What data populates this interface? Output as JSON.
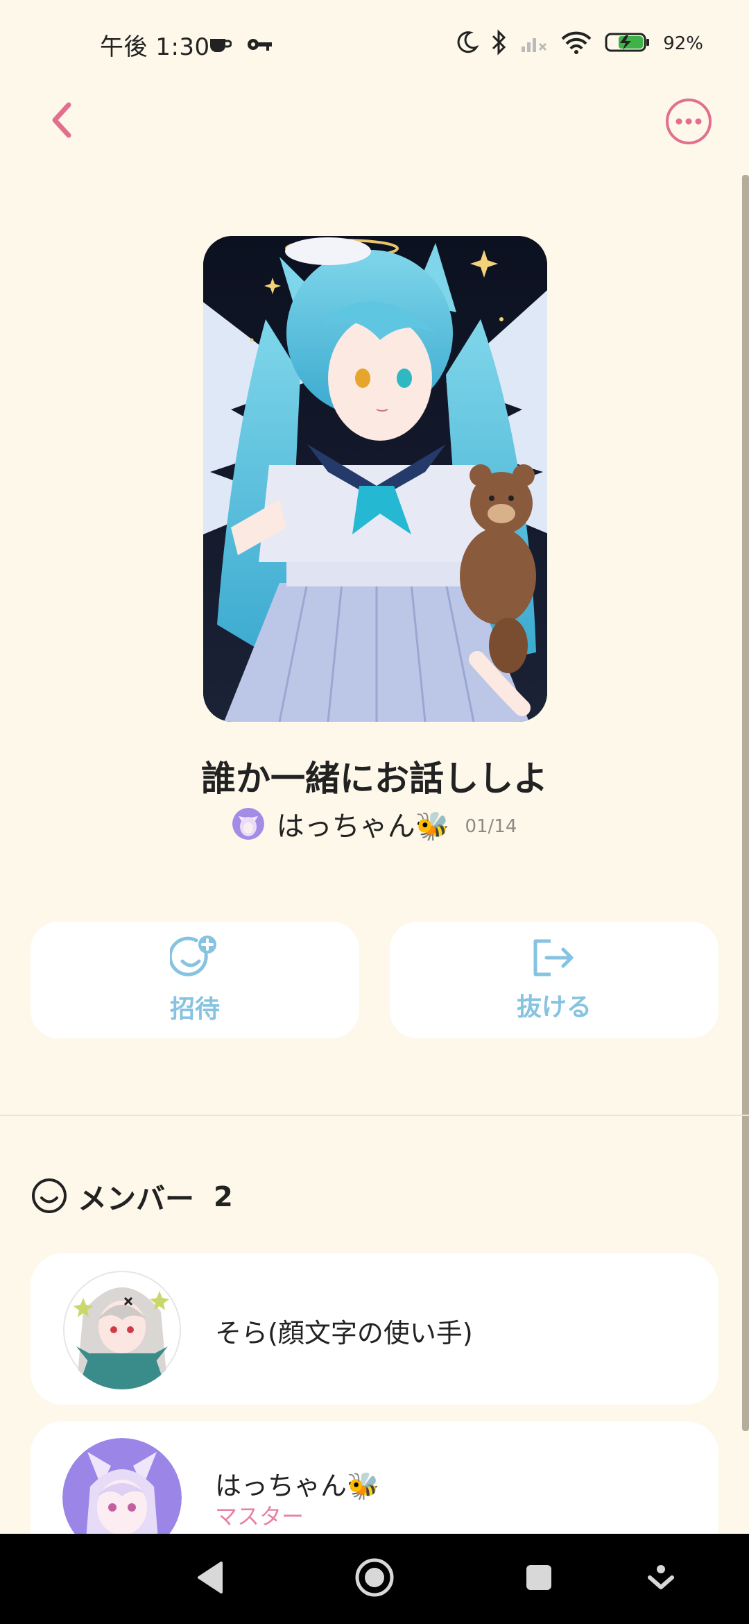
{
  "status_bar": {
    "time": "午後 1:30",
    "battery": "92%",
    "icons": [
      "cup-icon",
      "key-icon",
      "moon-icon",
      "bluetooth-icon",
      "signal-icon",
      "wifi-icon",
      "battery-charging-icon"
    ]
  },
  "header": {
    "back_icon": "chevron-left-icon",
    "more_icon": "more-circle-icon"
  },
  "room": {
    "title": "誰か一緒にお話ししよ",
    "host_name": "はっちゃん🐝",
    "date": "01/14"
  },
  "actions": {
    "invite_label": "招待",
    "leave_label": "抜ける"
  },
  "members": {
    "title": "メンバー",
    "count": "2",
    "items": [
      {
        "name": "そら(顔文字の使い手)",
        "role": ""
      },
      {
        "name": "はっちゃん🐝",
        "role": "マスター"
      }
    ]
  },
  "colors": {
    "background": "#fdf8ea",
    "accent_pink": "#e0708e",
    "accent_blue": "#86c3e1",
    "card": "#ffffff"
  }
}
